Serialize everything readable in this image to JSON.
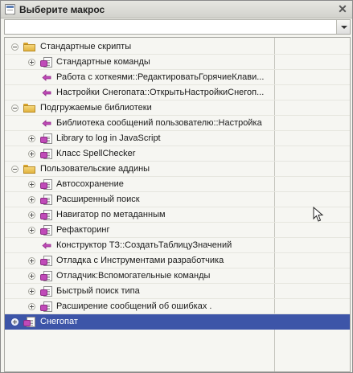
{
  "window": {
    "title": "Выберите макрос",
    "close_label": "✕"
  },
  "search": {
    "value": "",
    "placeholder": ""
  },
  "tree": {
    "rows": [
      {
        "label": "Стандартные скрипты",
        "type": "folder",
        "expander": "minus",
        "level": 0
      },
      {
        "label": "Стандартные команды",
        "type": "command",
        "expander": "plus",
        "level": 1
      },
      {
        "label": "Работа с хоткеями::РедактироватьГорячиеКлави...",
        "type": "macro",
        "expander": "none",
        "level": 1
      },
      {
        "label": "Настройки Снегопата::ОткрытьНастройкиСнегоп...",
        "type": "macro",
        "expander": "none",
        "level": 1
      },
      {
        "label": "Подгружаемые библиотеки",
        "type": "folder",
        "expander": "minus",
        "level": 0
      },
      {
        "label": "Библиотека сообщений пользователю::Настройка",
        "type": "macro",
        "expander": "none",
        "level": 1
      },
      {
        "label": "Library to log in JavaScript",
        "type": "command",
        "expander": "plus",
        "level": 1
      },
      {
        "label": "Класс SpellChecker",
        "type": "command",
        "expander": "plus",
        "level": 1
      },
      {
        "label": "Пользовательские аддины",
        "type": "folder",
        "expander": "minus",
        "level": 0
      },
      {
        "label": "Автосохранение",
        "type": "command",
        "expander": "plus",
        "level": 1
      },
      {
        "label": "Расширенный поиск",
        "type": "command",
        "expander": "plus",
        "level": 1
      },
      {
        "label": "Навигатор по метаданным",
        "type": "command",
        "expander": "plus",
        "level": 1
      },
      {
        "label": "Рефакторинг",
        "type": "command",
        "expander": "plus",
        "level": 1
      },
      {
        "label": "Конструктор ТЗ::СоздатьТаблицуЗначений",
        "type": "macro",
        "expander": "none",
        "level": 1
      },
      {
        "label": "Отладка с Инструментами разработчика",
        "type": "command",
        "expander": "plus",
        "level": 1
      },
      {
        "label": "Отладчик:Вспомогательные команды",
        "type": "command",
        "expander": "plus",
        "level": 1
      },
      {
        "label": "Быстрый поиск типа",
        "type": "command",
        "expander": "plus",
        "level": 1
      },
      {
        "label": "Расширение сообщений об ошибках .",
        "type": "command",
        "expander": "plus",
        "level": 1
      },
      {
        "label": "Снегопат",
        "type": "command",
        "expander": "plus",
        "level": 0,
        "selected": true
      }
    ]
  },
  "colors": {
    "selection": "#3d55a8",
    "command_badge": "#c04ab8",
    "folder": "#e2b440"
  }
}
